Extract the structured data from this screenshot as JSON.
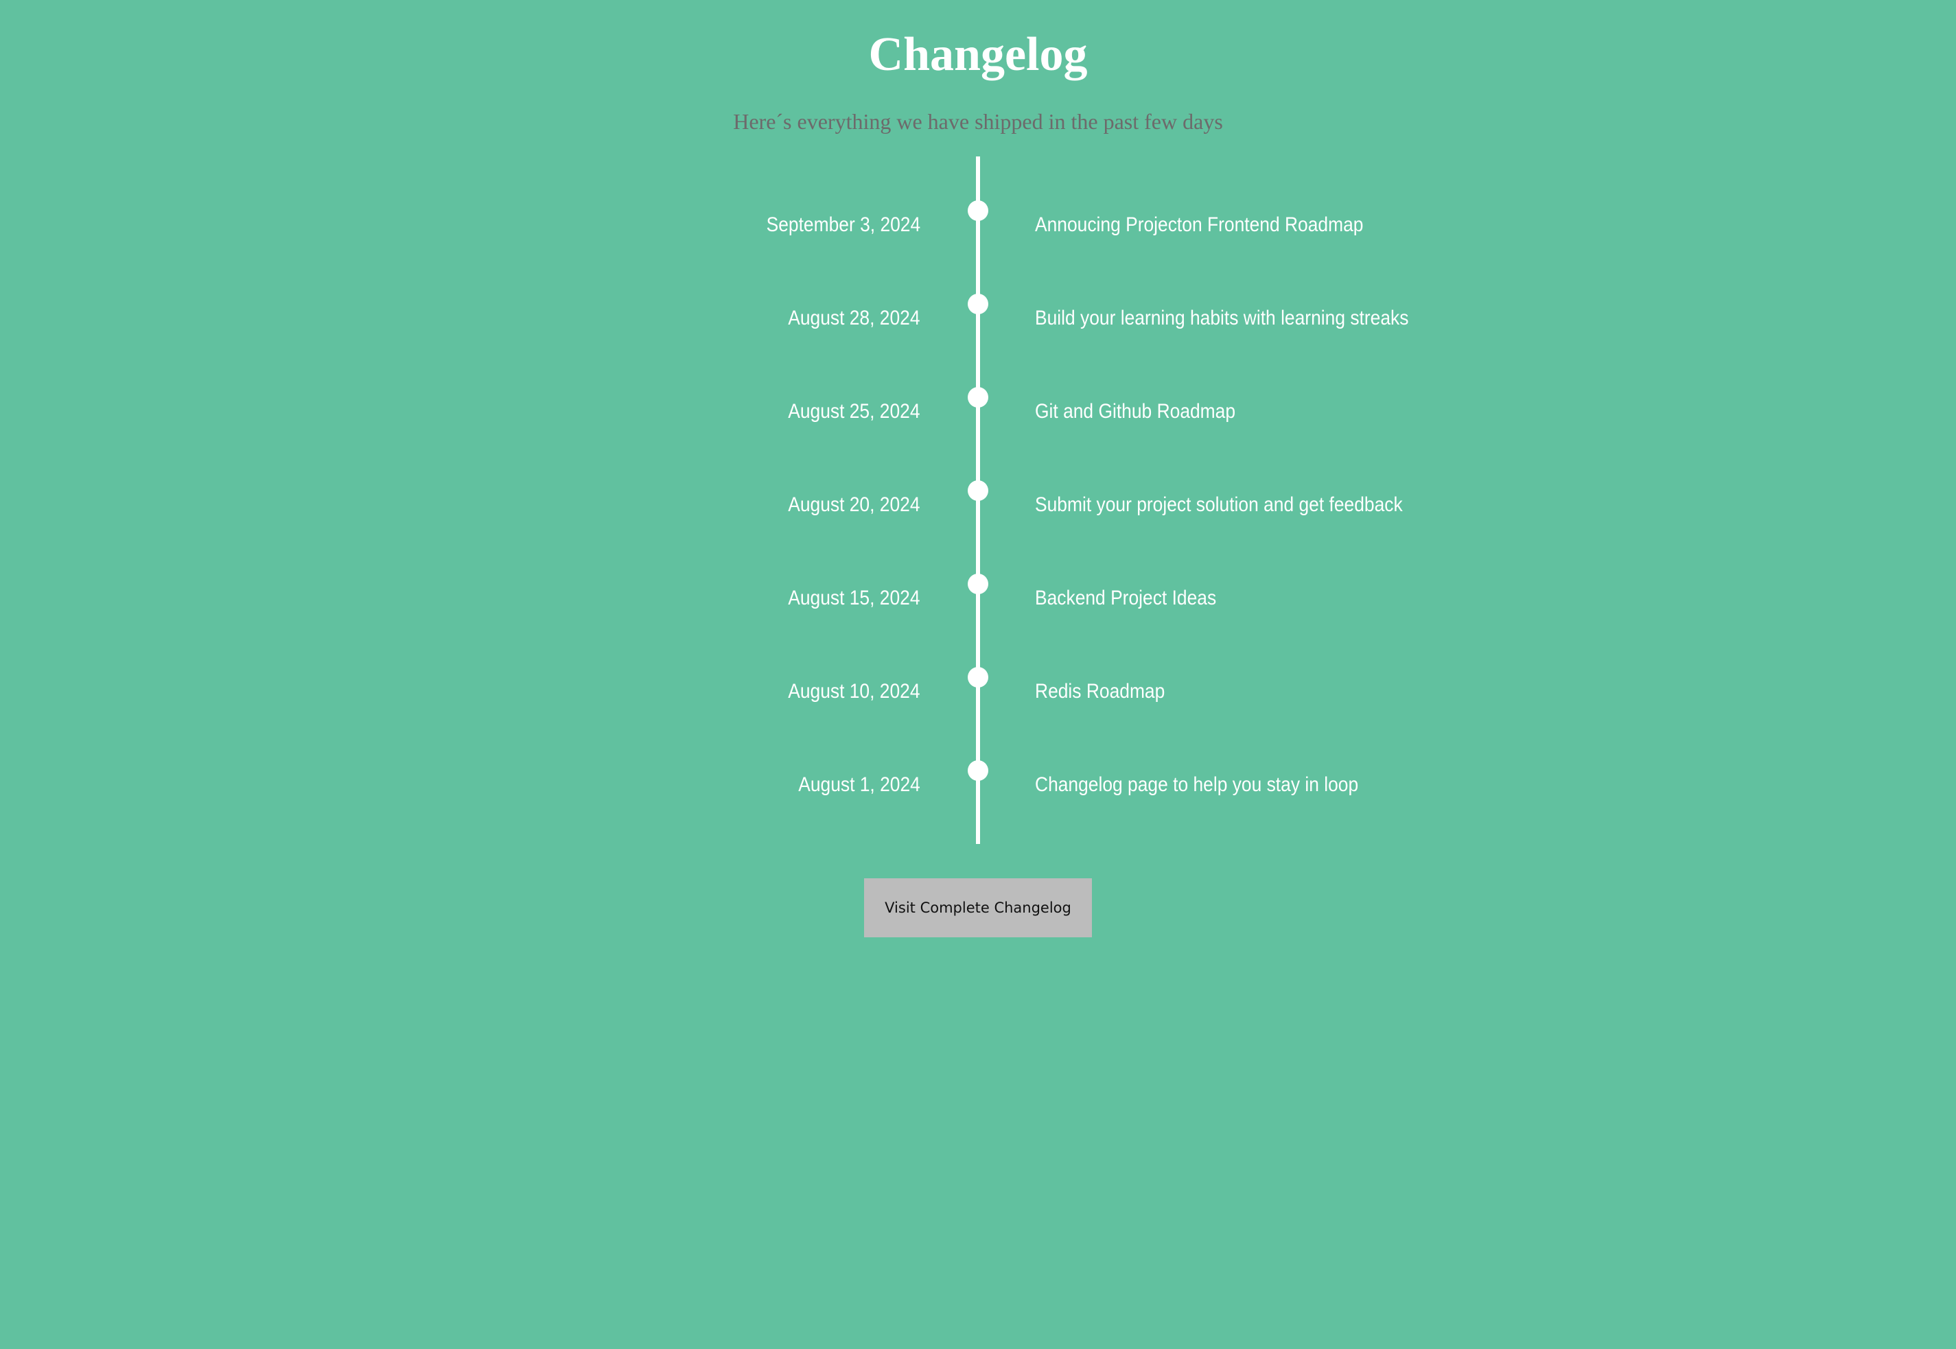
{
  "header": {
    "title": "Changelog",
    "subtitle": "Here´s everything we have shipped in the past few days"
  },
  "timeline": {
    "entries": [
      {
        "date": "September 3, 2024",
        "title": "Annoucing Projecton Frontend Roadmap"
      },
      {
        "date": "August 28, 2024",
        "title": "Build your learning habits with learning streaks"
      },
      {
        "date": "August 25, 2024",
        "title": "Git and Github Roadmap"
      },
      {
        "date": "August 20, 2024",
        "title": "Submit your project solution and get feedback"
      },
      {
        "date": "August 15, 2024",
        "title": "Backend Project Ideas"
      },
      {
        "date": "August 10, 2024",
        "title": "Redis Roadmap"
      },
      {
        "date": "August 1, 2024",
        "title": "Changelog page to help you stay in loop"
      }
    ]
  },
  "cta": {
    "label": "Visit Complete Changelog"
  },
  "colors": {
    "background": "#61c19f",
    "title": "#ffffff",
    "subtitle": "#6d6a6b",
    "timeline": "#ffffff",
    "button_bg": "#bcbcbc"
  }
}
